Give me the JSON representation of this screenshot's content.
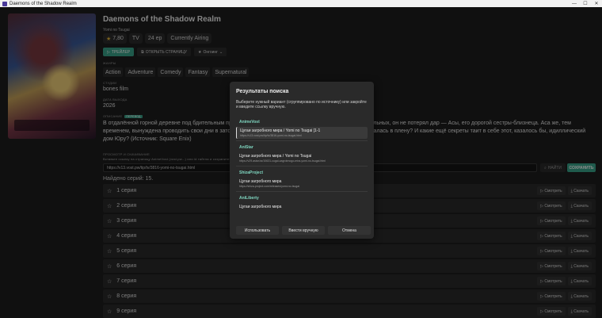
{
  "window": {
    "title": "Daemons of the Shadow Realm",
    "minimize": "—",
    "maximize": "☐",
    "close": "✕"
  },
  "show": {
    "title": "Daemons of the Shadow Realm",
    "subtitle": "Yomi no Tsugai",
    "rating": "7,80",
    "type": "TV",
    "episodes": "24 ep",
    "status": "Currently Airing"
  },
  "actions": {
    "trailer": "ТРЕЙЛЕР",
    "open_page": "ОТКРЫТЬ СТРАНИЦУ",
    "watch_status": "Онгоинг"
  },
  "labels": {
    "genres": "ЖАНРЫ",
    "studio": "СТУДИИ",
    "year": "ДАТА ВЫХОДА",
    "description": "ОПИСАНИЕ",
    "description_badge": "ПЕРЕВОД",
    "view": "ПРОСМОТР И СКАЧИВАНИЕ",
    "view_hint": "Вставьте ссылку на страницу AnimeVost (vost.pw...) или id тайтла и сохраните вручную."
  },
  "genres": [
    "Action",
    "Adventure",
    "Comedy",
    "Fantasy",
    "Supernatural"
  ],
  "studio": "bones film",
  "year": "2026",
  "description": "В отдалённой горной деревне под бдительным присмотром жителей растёт Юру. В отличие от всех остальных, он не потерял дар — Асы, его дорогой сестры-близнеца. Аса же, тем временем, вынуждена проводить свои дни в заточении... Кто же заключил её в клетку? Почему Аса оказалась в плену? И какие ещё секреты таит в себе этот, казалось бы, идиллический дом Юру? (Источник: Square Enix)",
  "url_input": {
    "value": "https://v13.vost.pw/tip/tv/3816-yomi-no-tsugai.html"
  },
  "find_button": "НАЙТИ",
  "save_button": "СОХРАНИТЬ",
  "found_text": "Найдено серий: 15.",
  "episode_actions": {
    "watch": "▷ Смотреть",
    "download": "⤓ Скачать"
  },
  "episode_list": [
    "1 серия",
    "2 серия",
    "3 серия",
    "4 серия",
    "5 серия",
    "6 серия",
    "7 серия",
    "8 серия",
    "9 серия"
  ],
  "dialog": {
    "title": "Результаты поиска",
    "hint": "Выберите нужный вариант (сгруппировано по источнику) или закройте и введите ссылку вручную.",
    "groups": [
      {
        "source": "AnimeVost",
        "results": [
          {
            "title": "Цугаи загробного мира / Yomi no Tsugai [1-1",
            "url": "https://v13.vost.pw/tip/tv/3816-yomi-no-tsugai.html"
          }
        ]
      },
      {
        "source": "AniStar",
        "results": [
          {
            "title": "Цугаи загробного мира / Yomi no Tsugai",
            "url": "https://v29.astar.bz/10631-cugai-zagrobnogo-mira-yomi-no-tsugai.html"
          }
        ]
      },
      {
        "source": "ShizaProject",
        "results": [
          {
            "title": "Цугаи загробного мира",
            "url": "https://shiza-project.com/releases/yomi-no-tsugai"
          }
        ]
      },
      {
        "source": "AniLiberty",
        "results": [
          {
            "title": "Цугаи загробного мира",
            "url": ""
          }
        ]
      }
    ],
    "buttons": {
      "use": "Использовать",
      "manual": "Ввести вручную",
      "cancel": "Отмена"
    }
  }
}
